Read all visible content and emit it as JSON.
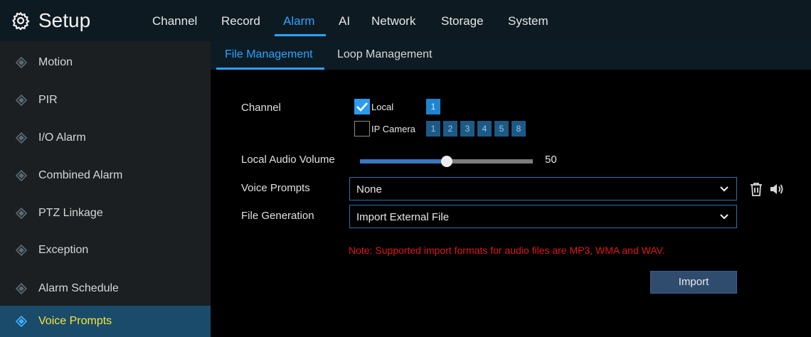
{
  "header": {
    "title": "Setup",
    "tabs": [
      {
        "label": "Channel",
        "active": false
      },
      {
        "label": "Record",
        "active": false
      },
      {
        "label": "Alarm",
        "active": true
      },
      {
        "label": "AI",
        "active": false
      },
      {
        "label": "Network",
        "active": false
      },
      {
        "label": "Storage",
        "active": false
      },
      {
        "label": "System",
        "active": false
      }
    ]
  },
  "sidebar": {
    "items": [
      {
        "label": "Motion",
        "active": false
      },
      {
        "label": "PIR",
        "active": false
      },
      {
        "label": "I/O Alarm",
        "active": false
      },
      {
        "label": "Combined Alarm",
        "active": false
      },
      {
        "label": "PTZ Linkage",
        "active": false
      },
      {
        "label": "Exception",
        "active": false
      },
      {
        "label": "Alarm Schedule",
        "active": false
      },
      {
        "label": "Voice Prompts",
        "active": true
      }
    ]
  },
  "subtabs": [
    {
      "label": "File Management",
      "active": true
    },
    {
      "label": "Loop Management",
      "active": false
    }
  ],
  "form": {
    "channel_label": "Channel",
    "local_label": "Local",
    "local_checked": true,
    "local_channels": [
      "1"
    ],
    "ip_camera_label": "IP Camera",
    "ip_camera_checked": false,
    "ip_channels": [
      "1",
      "2",
      "3",
      "4",
      "5",
      "8"
    ],
    "volume_label": "Local Audio Volume",
    "volume_value": 50,
    "volume_max": 100,
    "voice_prompts_label": "Voice Prompts",
    "voice_prompts_value": "None",
    "file_generation_label": "File Generation",
    "file_generation_value": "Import External File",
    "note": "Note: Supported import formats for audio files are MP3, WMA and WAV.",
    "import_label": "Import"
  },
  "colors": {
    "accent": "#28a5ff",
    "active_side_text": "#f3e63a",
    "note": "#e0171a"
  }
}
